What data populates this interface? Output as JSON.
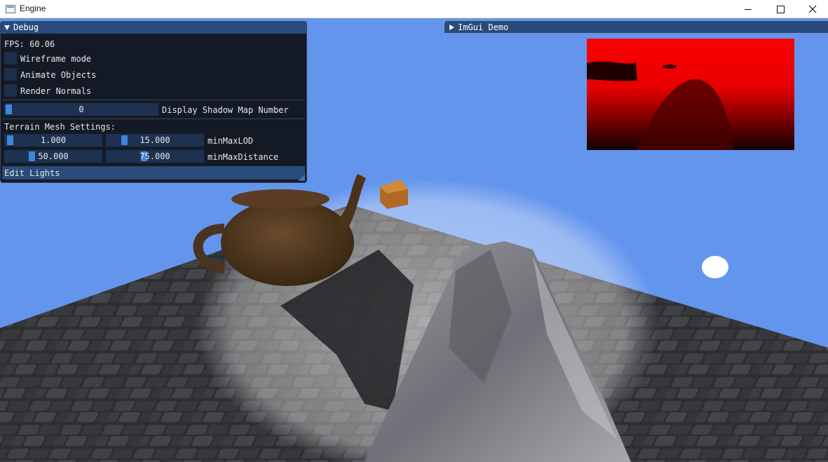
{
  "window": {
    "title": "Engine",
    "icon": "app-window-icon",
    "controls": {
      "minimize": "minimize-icon",
      "maximize": "maximize-icon",
      "close": "close-icon"
    }
  },
  "debug_panel": {
    "title": "Debug",
    "collapsed": false,
    "fps_label": "FPS: 60.06",
    "checkboxes": [
      {
        "label": "Wireframe mode",
        "checked": false
      },
      {
        "label": "Animate Objects",
        "checked": false
      },
      {
        "label": "Render Normals",
        "checked": false
      }
    ],
    "shadow_map": {
      "value": "0",
      "label": "Display Shadow Map Number"
    },
    "terrain": {
      "section_label": "Terrain Mesh Settings:",
      "lod": {
        "min": "1.000",
        "max": "15.000",
        "label": "minMaxLOD"
      },
      "distance": {
        "min": "50.000",
        "max": "75.000",
        "label": "minMaxDistance"
      }
    },
    "edit_lights_label": "Edit Lights"
  },
  "demo_panel": {
    "title": "ImGui Demo",
    "collapsed": true
  },
  "colors": {
    "sky": "#6495ed",
    "imgui_header": "#294a7a",
    "imgui_window_bg": "#0f1218",
    "slider_grab": "#3d85e0",
    "shadow_map_red": "#ff0000"
  }
}
